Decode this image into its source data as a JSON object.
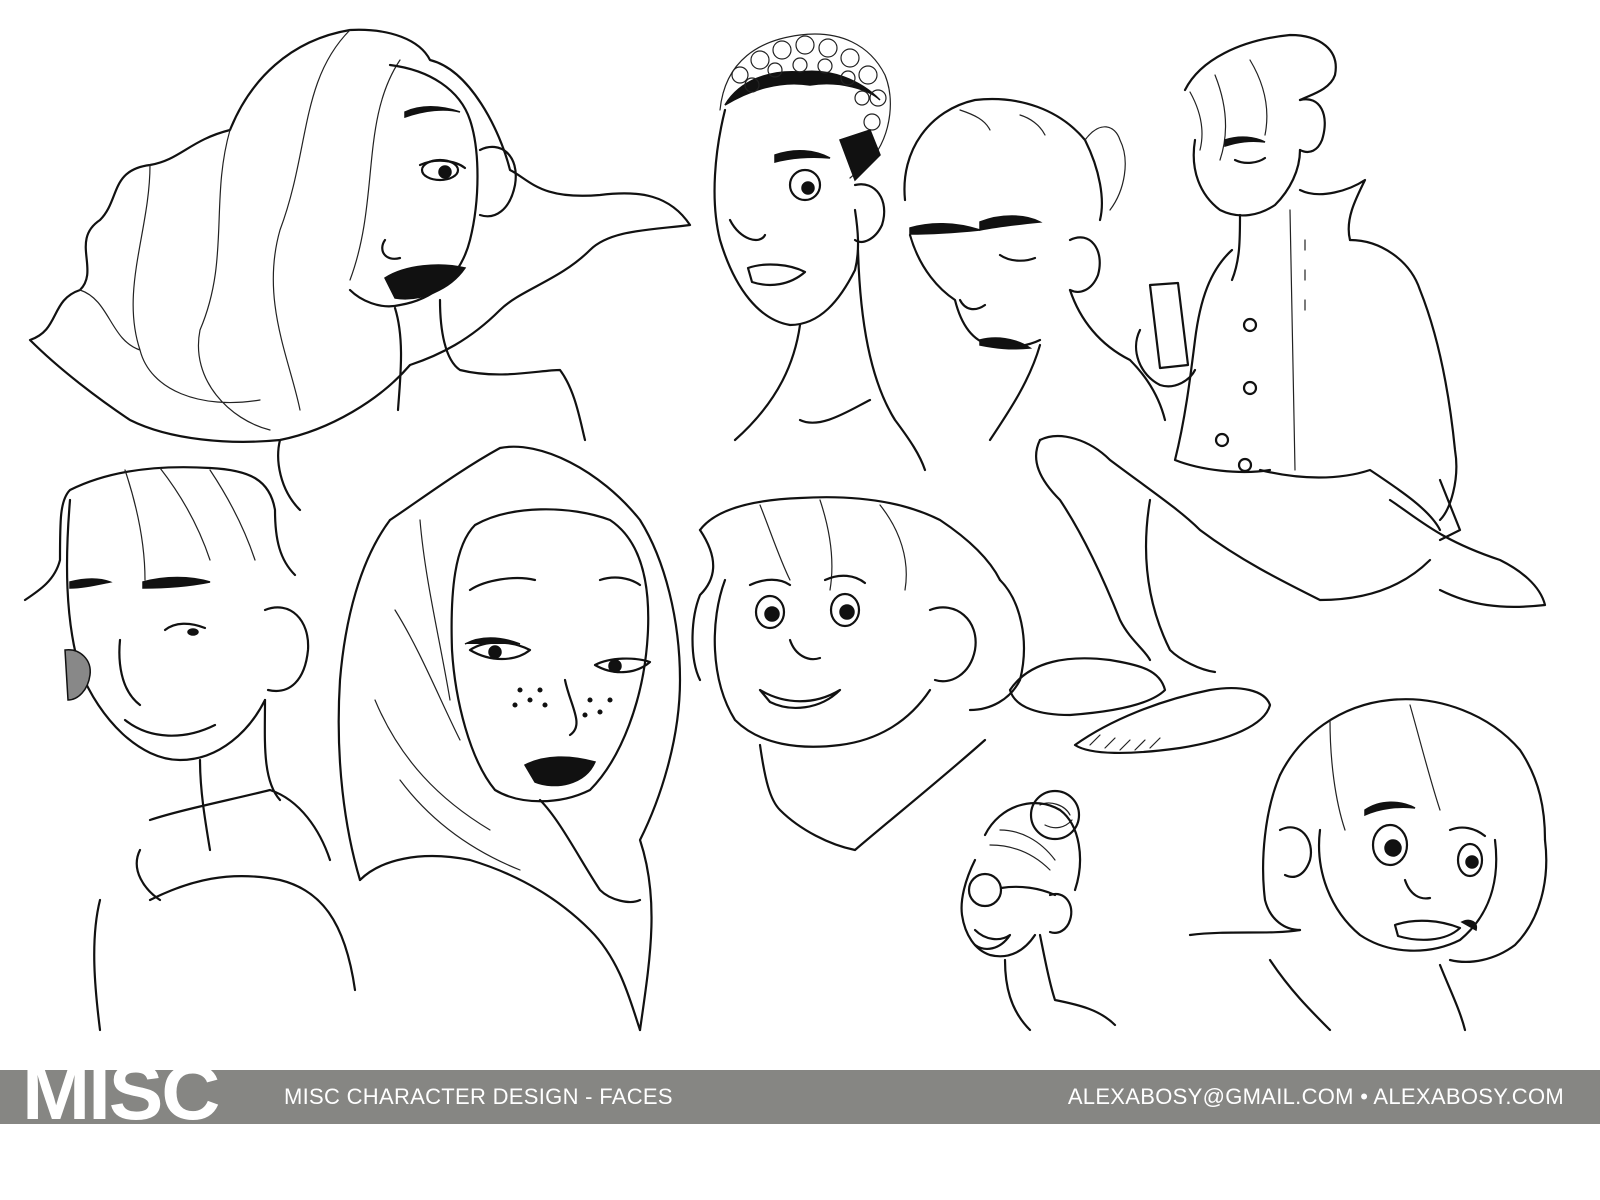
{
  "sheet": {
    "background_color": "#ffffff",
    "ink_color": "#111111",
    "sketches": [
      "woman-wavy-hair",
      "young-man-curly-hair",
      "bald-older-man",
      "young-man-with-phone-seated",
      "young-man-side-part",
      "woman-hijab-freckles",
      "round-face-smiling",
      "woman-hair-bun-glasses",
      "girl-bob-haircut"
    ]
  },
  "footer": {
    "logo_text": "MISC",
    "title": "MISC CHARACTER DESIGN - FACES",
    "contact": "ALEXABOSY@GMAIL.COM • ALEXABOSY.COM",
    "bar_color": "#868683",
    "text_color": "#ffffff"
  }
}
